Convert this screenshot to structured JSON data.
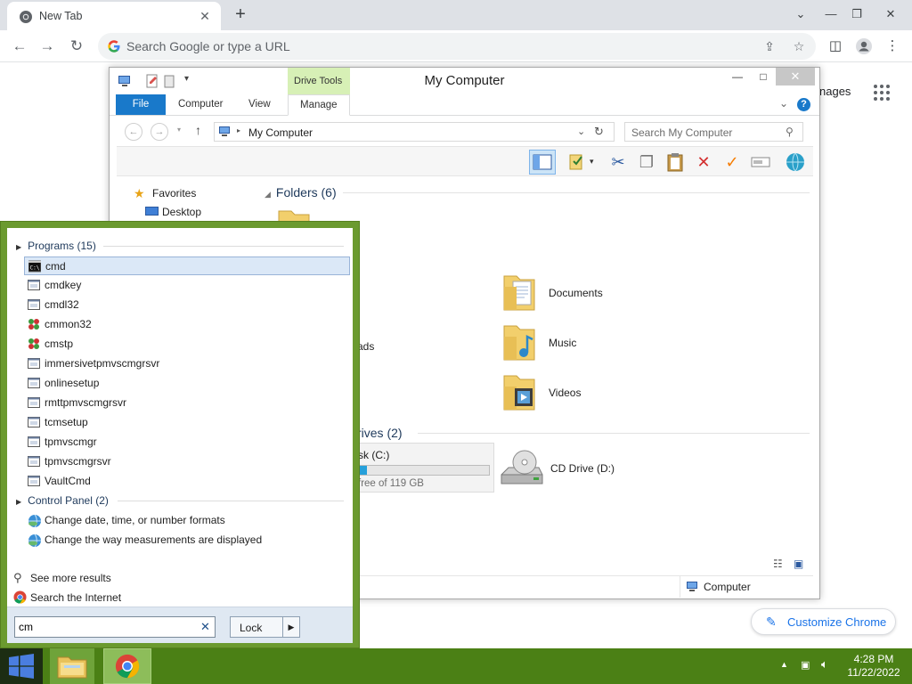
{
  "browser": {
    "tab_title": "New Tab",
    "omnibox_placeholder": "Search Google or type a URL",
    "ntp_images_link": "nages",
    "customize_label": "Customize Chrome"
  },
  "explorer": {
    "title": "My Computer",
    "drive_tools_label": "Drive Tools",
    "ribbon_tabs": {
      "file": "File",
      "computer": "Computer",
      "view": "View",
      "manage": "Manage"
    },
    "breadcrumb": "My Computer",
    "search_placeholder": "Search My Computer",
    "nav": {
      "favorites": "Favorites",
      "desktop": "Desktop"
    },
    "folders_header": "Folders (6)",
    "folders": {
      "documents": "Documents",
      "music": "Music",
      "videos": "Videos",
      "downloads_partial": "ads"
    },
    "drives_header_partial": "rives (2)",
    "local_disk": {
      "name_partial": "sk (C:)",
      "free_partial": "free of 119 GB",
      "used_fraction": 0.06
    },
    "cd_drive": "CD Drive (D:)",
    "status_selection": "Computer"
  },
  "start_search": {
    "programs_header": "Programs (15)",
    "programs": [
      {
        "name": "cmd",
        "icon": "console-icon"
      },
      {
        "name": "cmdkey",
        "icon": "app-window-icon"
      },
      {
        "name": "cmdl32",
        "icon": "app-window-icon"
      },
      {
        "name": "cmmon32",
        "icon": "network-icon"
      },
      {
        "name": "cmstp",
        "icon": "network-icon"
      },
      {
        "name": "immersivetpmvscmgrsvr",
        "icon": "app-window-icon"
      },
      {
        "name": "onlinesetup",
        "icon": "app-window-icon"
      },
      {
        "name": "rmttpmvscmgrsvr",
        "icon": "app-window-icon"
      },
      {
        "name": "tcmsetup",
        "icon": "app-window-icon"
      },
      {
        "name": "tpmvscmgr",
        "icon": "app-window-icon"
      },
      {
        "name": "tpmvscmgrsvr",
        "icon": "app-window-icon"
      },
      {
        "name": "VaultCmd",
        "icon": "app-window-icon"
      }
    ],
    "control_panel_header": "Control Panel (2)",
    "control_panel": [
      {
        "name": "Change date, time, or number formats"
      },
      {
        "name": "Change the way measurements are displayed"
      }
    ],
    "see_more": "See more results",
    "search_internet": "Search the Internet",
    "query": "cm",
    "lock_label": "Lock"
  },
  "taskbar": {
    "time": "4:28 PM",
    "date": "11/22/2022"
  },
  "colors": {
    "start_panel": "#6b9a2f",
    "taskbar": "#4b8015",
    "ribbon_file": "#1979ca",
    "drive_tools": "#d7f0b6",
    "link_blue": "#1a73e8"
  }
}
